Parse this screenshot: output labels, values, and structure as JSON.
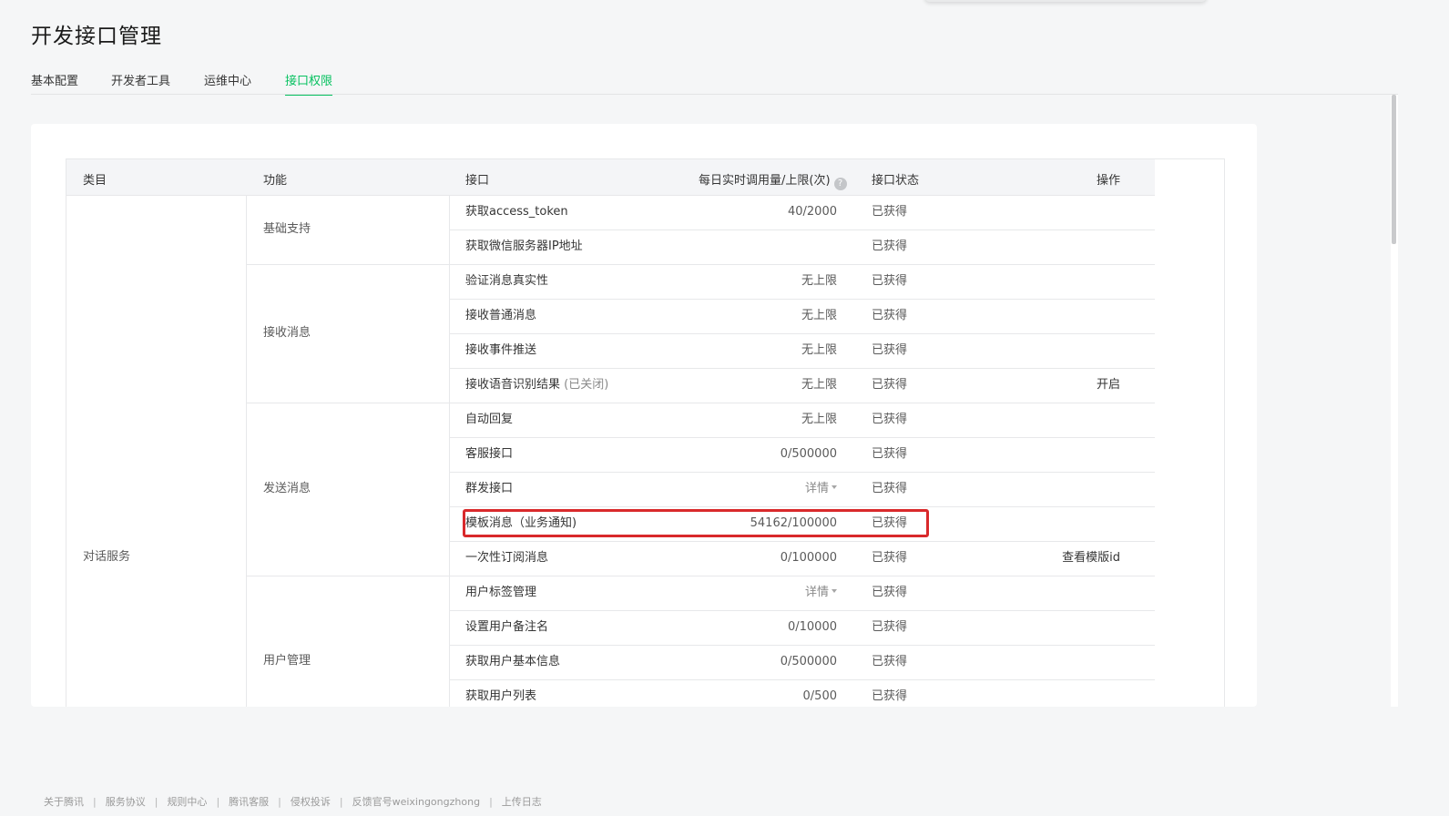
{
  "page": {
    "title": "开发接口管理"
  },
  "tabs": [
    {
      "label": "基本配置"
    },
    {
      "label": "开发者工具"
    },
    {
      "label": "运维中心"
    },
    {
      "label": "接口权限",
      "active": true
    }
  ],
  "colors": {
    "accent": "#07c160",
    "highlight": "#d9292b"
  },
  "table": {
    "headers": {
      "category": "类目",
      "function": "功能",
      "interface": "接口",
      "usage": "每日实时调用量/上限(次)",
      "status": "接口状态",
      "action": "操作"
    },
    "category": "对话服务",
    "groups": [
      {
        "name": "基础支持"
      },
      {
        "name": "接收消息"
      },
      {
        "name": "发送消息"
      },
      {
        "name": "用户管理"
      }
    ],
    "rows": [
      {
        "name": "获取access_token",
        "usage": "40/2000",
        "status": "已获得",
        "action": ""
      },
      {
        "name": "获取微信服务器IP地址",
        "usage": "",
        "status": "已获得",
        "action": ""
      },
      {
        "name": "验证消息真实性",
        "usage": "无上限",
        "status": "已获得",
        "action": ""
      },
      {
        "name": "接收普通消息",
        "usage": "无上限",
        "status": "已获得",
        "action": ""
      },
      {
        "name": "接收事件推送",
        "usage": "无上限",
        "status": "已获得",
        "action": ""
      },
      {
        "name": "接收语音识别结果",
        "note": "(已关闭)",
        "usage": "无上限",
        "status": "已获得",
        "action": "开启"
      },
      {
        "name": "自动回复",
        "usage": "无上限",
        "status": "已获得",
        "action": ""
      },
      {
        "name": "客服接口",
        "usage": "0/500000",
        "status": "已获得",
        "action": ""
      },
      {
        "name": "群发接口",
        "usage": "详情",
        "status": "已获得",
        "action": ""
      },
      {
        "name": "模板消息（业务通知)",
        "usage": "54162/100000",
        "status": "已获得",
        "action": ""
      },
      {
        "name": "一次性订阅消息",
        "usage": "0/100000",
        "status": "已获得",
        "action": "查看模版id"
      },
      {
        "name": "用户标签管理",
        "usage": "详情",
        "status": "已获得",
        "action": ""
      },
      {
        "name": "设置用户备注名",
        "usage": "0/10000",
        "status": "已获得",
        "action": ""
      },
      {
        "name": "获取用户基本信息",
        "usage": "0/500000",
        "status": "已获得",
        "action": ""
      },
      {
        "name": "获取用户列表",
        "usage": "0/500",
        "status": "已获得",
        "action": ""
      }
    ]
  },
  "footer": {
    "links": [
      "关于腾讯",
      "服务协议",
      "规则中心",
      "腾讯客服",
      "侵权投诉",
      "反馈官号weixingongzhong",
      "上传日志"
    ],
    "separator": "|"
  }
}
